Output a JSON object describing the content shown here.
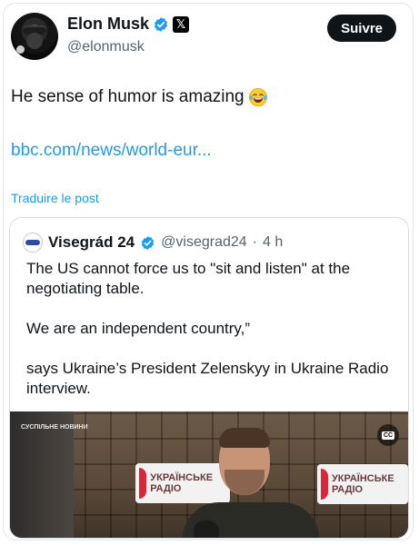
{
  "author": {
    "display_name": "Elon Musk",
    "handle": "@elonmusk",
    "x_badge_glyph": "𝕏",
    "follow_label": "Suivre"
  },
  "tweet": {
    "text": "He sense of humor is amazing",
    "emoji": "laughing-tears-emoji",
    "link": "bbc.com/news/world-eur...",
    "translate_label": "Traduire le post"
  },
  "quote": {
    "display_name": "Visegrád 24",
    "handle": "@visegrad24",
    "separator": "·",
    "time": "4 h",
    "paragraphs": [
      "The US cannot force us to \"sit and listen\" at the negotiating table.",
      "We are an independent country,”",
      "says Ukraine’s President Zelenskyy in Ukraine Radio interview."
    ],
    "media": {
      "sign_text": "УКРАЇНСЬКЕ РАДІО",
      "channel_logo": "СУСПІЛЬНЕ НОВИНИ",
      "cc_label": "CC"
    }
  },
  "colors": {
    "accent": "#1d9bf0",
    "text": "#0f1419",
    "secondary_text": "#536471",
    "button_bg": "#0f1419"
  }
}
